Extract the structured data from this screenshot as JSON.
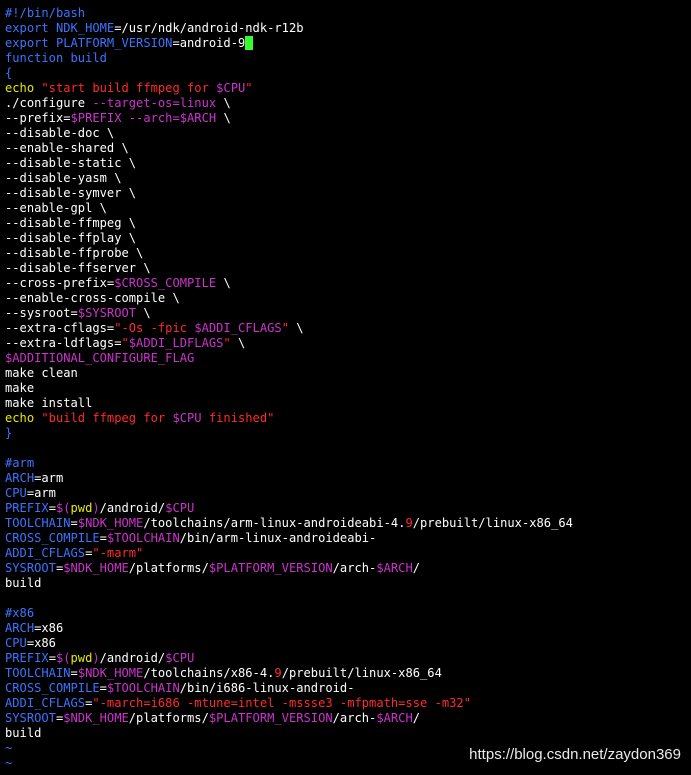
{
  "colors": {
    "background": "#000000",
    "default_text": "#ffffff",
    "keyword_blue": "#3b74ff",
    "builtin_yellow": "#e8e800",
    "string_red": "#ff2a2a",
    "variable_magenta": "#cc33cc",
    "cursor_green": "#33ff33"
  },
  "editor": {
    "lines": [
      [
        {
          "t": "#!/bin/bash",
          "c": "blue"
        }
      ],
      [
        {
          "t": "export ",
          "c": "blue"
        },
        {
          "t": "NDK_HOME",
          "c": "blue"
        },
        {
          "t": "=/usr/ndk/android-ndk-r12b",
          "c": "white"
        }
      ],
      [
        {
          "t": "export ",
          "c": "blue"
        },
        {
          "t": "PLATFORM_VERSION",
          "c": "blue"
        },
        {
          "t": "=android-9",
          "c": "white"
        },
        {
          "t": " ",
          "c": "cursor"
        }
      ],
      [
        {
          "t": "function build",
          "c": "blue"
        }
      ],
      [
        {
          "t": "{",
          "c": "blue"
        }
      ],
      [
        {
          "t": "echo ",
          "c": "yellow"
        },
        {
          "t": "\"start build ffmpeg for ",
          "c": "red"
        },
        {
          "t": "$CPU",
          "c": "magenta"
        },
        {
          "t": "\"",
          "c": "red"
        }
      ],
      [
        {
          "t": "./configure ",
          "c": "white"
        },
        {
          "t": "--target-os=linux ",
          "c": "magenta"
        },
        {
          "t": "\\",
          "c": "white"
        }
      ],
      [
        {
          "t": "--prefix=",
          "c": "white"
        },
        {
          "t": "$PREFIX ",
          "c": "magenta"
        },
        {
          "t": "--arch=",
          "c": "magenta"
        },
        {
          "t": "$ARCH ",
          "c": "magenta"
        },
        {
          "t": "\\",
          "c": "white"
        }
      ],
      [
        {
          "t": "--disable-doc \\",
          "c": "white"
        }
      ],
      [
        {
          "t": "--enable-shared \\",
          "c": "white"
        }
      ],
      [
        {
          "t": "--disable-static \\",
          "c": "white"
        }
      ],
      [
        {
          "t": "--disable-yasm \\",
          "c": "white"
        }
      ],
      [
        {
          "t": "--disable-symver \\",
          "c": "white"
        }
      ],
      [
        {
          "t": "--enable-gpl \\",
          "c": "white"
        }
      ],
      [
        {
          "t": "--disable-ffmpeg \\",
          "c": "white"
        }
      ],
      [
        {
          "t": "--disable-ffplay \\",
          "c": "white"
        }
      ],
      [
        {
          "t": "--disable-ffprobe \\",
          "c": "white"
        }
      ],
      [
        {
          "t": "--disable-ffserver \\",
          "c": "white"
        }
      ],
      [
        {
          "t": "--cross-prefix=",
          "c": "white"
        },
        {
          "t": "$CROSS_COMPILE ",
          "c": "magenta"
        },
        {
          "t": "\\",
          "c": "white"
        }
      ],
      [
        {
          "t": "--enable-cross-compile \\",
          "c": "white"
        }
      ],
      [
        {
          "t": "--sysroot=",
          "c": "white"
        },
        {
          "t": "$SYSROOT ",
          "c": "magenta"
        },
        {
          "t": "\\",
          "c": "white"
        }
      ],
      [
        {
          "t": "--extra-cflags=",
          "c": "white"
        },
        {
          "t": "\"-Os -fpic ",
          "c": "red"
        },
        {
          "t": "$ADDI_CFLAGS",
          "c": "magenta"
        },
        {
          "t": "\" ",
          "c": "red"
        },
        {
          "t": "\\",
          "c": "white"
        }
      ],
      [
        {
          "t": "--extra-ldflags=",
          "c": "white"
        },
        {
          "t": "\"",
          "c": "red"
        },
        {
          "t": "$ADDI_LDFLAGS",
          "c": "magenta"
        },
        {
          "t": "\" ",
          "c": "red"
        },
        {
          "t": "\\",
          "c": "white"
        }
      ],
      [
        {
          "t": "$ADDITIONAL_CONFIGURE_FLAG",
          "c": "magenta"
        }
      ],
      [
        {
          "t": "make clean",
          "c": "white"
        }
      ],
      [
        {
          "t": "make",
          "c": "white"
        }
      ],
      [
        {
          "t": "make install",
          "c": "white"
        }
      ],
      [
        {
          "t": "echo ",
          "c": "yellow"
        },
        {
          "t": "\"build ffmpeg for ",
          "c": "red"
        },
        {
          "t": "$CPU",
          "c": "magenta"
        },
        {
          "t": " finished\"",
          "c": "red"
        }
      ],
      [
        {
          "t": "}",
          "c": "blue"
        }
      ],
      [],
      [
        {
          "t": "#arm",
          "c": "blue"
        }
      ],
      [
        {
          "t": "ARCH",
          "c": "blue"
        },
        {
          "t": "=arm",
          "c": "white"
        }
      ],
      [
        {
          "t": "CPU",
          "c": "blue"
        },
        {
          "t": "=arm",
          "c": "white"
        }
      ],
      [
        {
          "t": "PREFIX",
          "c": "blue"
        },
        {
          "t": "=",
          "c": "white"
        },
        {
          "t": "$(",
          "c": "magenta"
        },
        {
          "t": "pwd",
          "c": "yellow"
        },
        {
          "t": ")",
          "c": "magenta"
        },
        {
          "t": "/android/",
          "c": "white"
        },
        {
          "t": "$CPU",
          "c": "magenta"
        }
      ],
      [
        {
          "t": "TOOLCHAIN",
          "c": "blue"
        },
        {
          "t": "=",
          "c": "white"
        },
        {
          "t": "$NDK_HOME",
          "c": "magenta"
        },
        {
          "t": "/toolchains/arm-linux-androideabi-4.",
          "c": "white"
        },
        {
          "t": "9",
          "c": "red"
        },
        {
          "t": "/prebuilt/linux-x86_64",
          "c": "white"
        }
      ],
      [
        {
          "t": "CROSS_COMPILE",
          "c": "blue"
        },
        {
          "t": "=",
          "c": "white"
        },
        {
          "t": "$TOOLCHAIN",
          "c": "magenta"
        },
        {
          "t": "/bin/arm-linux-androideabi-",
          "c": "white"
        }
      ],
      [
        {
          "t": "ADDI_CFLAGS",
          "c": "blue"
        },
        {
          "t": "=",
          "c": "white"
        },
        {
          "t": "\"-marm\"",
          "c": "red"
        }
      ],
      [
        {
          "t": "SYSROOT",
          "c": "blue"
        },
        {
          "t": "=",
          "c": "white"
        },
        {
          "t": "$NDK_HOME",
          "c": "magenta"
        },
        {
          "t": "/platforms/",
          "c": "white"
        },
        {
          "t": "$PLATFORM_VERSION",
          "c": "magenta"
        },
        {
          "t": "/arch-",
          "c": "white"
        },
        {
          "t": "$ARCH",
          "c": "magenta"
        },
        {
          "t": "/",
          "c": "white"
        }
      ],
      [
        {
          "t": "build",
          "c": "white"
        }
      ],
      [],
      [
        {
          "t": "#x86",
          "c": "blue"
        }
      ],
      [
        {
          "t": "ARCH",
          "c": "blue"
        },
        {
          "t": "=x86",
          "c": "white"
        }
      ],
      [
        {
          "t": "CPU",
          "c": "blue"
        },
        {
          "t": "=x86",
          "c": "white"
        }
      ],
      [
        {
          "t": "PREFIX",
          "c": "blue"
        },
        {
          "t": "=",
          "c": "white"
        },
        {
          "t": "$(",
          "c": "magenta"
        },
        {
          "t": "pwd",
          "c": "yellow"
        },
        {
          "t": ")",
          "c": "magenta"
        },
        {
          "t": "/android/",
          "c": "white"
        },
        {
          "t": "$CPU",
          "c": "magenta"
        }
      ],
      [
        {
          "t": "TOOLCHAIN",
          "c": "blue"
        },
        {
          "t": "=",
          "c": "white"
        },
        {
          "t": "$NDK_HOME",
          "c": "magenta"
        },
        {
          "t": "/toolchains/x86-4.",
          "c": "white"
        },
        {
          "t": "9",
          "c": "red"
        },
        {
          "t": "/prebuilt/linux-x86_64",
          "c": "white"
        }
      ],
      [
        {
          "t": "CROSS_COMPILE",
          "c": "blue"
        },
        {
          "t": "=",
          "c": "white"
        },
        {
          "t": "$TOOLCHAIN",
          "c": "magenta"
        },
        {
          "t": "/bin/i686-linux-android-",
          "c": "white"
        }
      ],
      [
        {
          "t": "ADDI_CFLAGS",
          "c": "blue"
        },
        {
          "t": "=",
          "c": "white"
        },
        {
          "t": "\"-march=i686 -mtune=intel -mssse3 -mfpmath=sse -m32\"",
          "c": "red"
        }
      ],
      [
        {
          "t": "SYSROOT",
          "c": "blue"
        },
        {
          "t": "=",
          "c": "white"
        },
        {
          "t": "$NDK_HOME",
          "c": "magenta"
        },
        {
          "t": "/platforms/",
          "c": "white"
        },
        {
          "t": "$PLATFORM_VERSION",
          "c": "magenta"
        },
        {
          "t": "/arch-",
          "c": "white"
        },
        {
          "t": "$ARCH",
          "c": "magenta"
        },
        {
          "t": "/",
          "c": "white"
        }
      ],
      [
        {
          "t": "build",
          "c": "white"
        }
      ],
      [
        {
          "t": "~",
          "c": "blue"
        }
      ],
      [
        {
          "t": "~",
          "c": "blue"
        }
      ]
    ]
  },
  "watermark": {
    "text": "https://blog.csdn.net/zaydon369"
  }
}
